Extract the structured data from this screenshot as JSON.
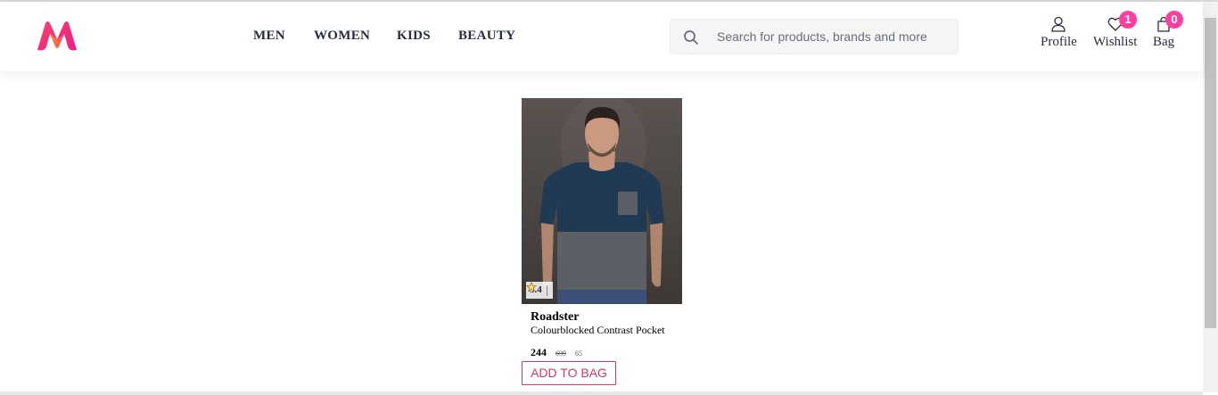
{
  "header": {
    "nav": [
      {
        "label": "MEN"
      },
      {
        "label": "WOMEN"
      },
      {
        "label": "KIDS"
      },
      {
        "label": "BEAUTY"
      }
    ],
    "search": {
      "placeholder": "Search for products, brands and more",
      "icon": "search-icon"
    },
    "actions": {
      "profile": {
        "label": "Profile",
        "icon": "user-icon"
      },
      "wishlist": {
        "label": "Wishlist",
        "icon": "heart-icon",
        "count": "1"
      },
      "bag": {
        "label": "Bag",
        "icon": "bag-icon",
        "count": "0"
      }
    },
    "badge_color": "#ff3f9f"
  },
  "product": {
    "brand": "Roadster",
    "name": "Colourblocked Contrast Pocket",
    "rating": "3.4",
    "rating_icon": "star-icon",
    "price": "244",
    "mrp": "699",
    "discount": "65",
    "add_to_bag_label": "ADD TO BAG",
    "accent_color": "#d4386e"
  }
}
